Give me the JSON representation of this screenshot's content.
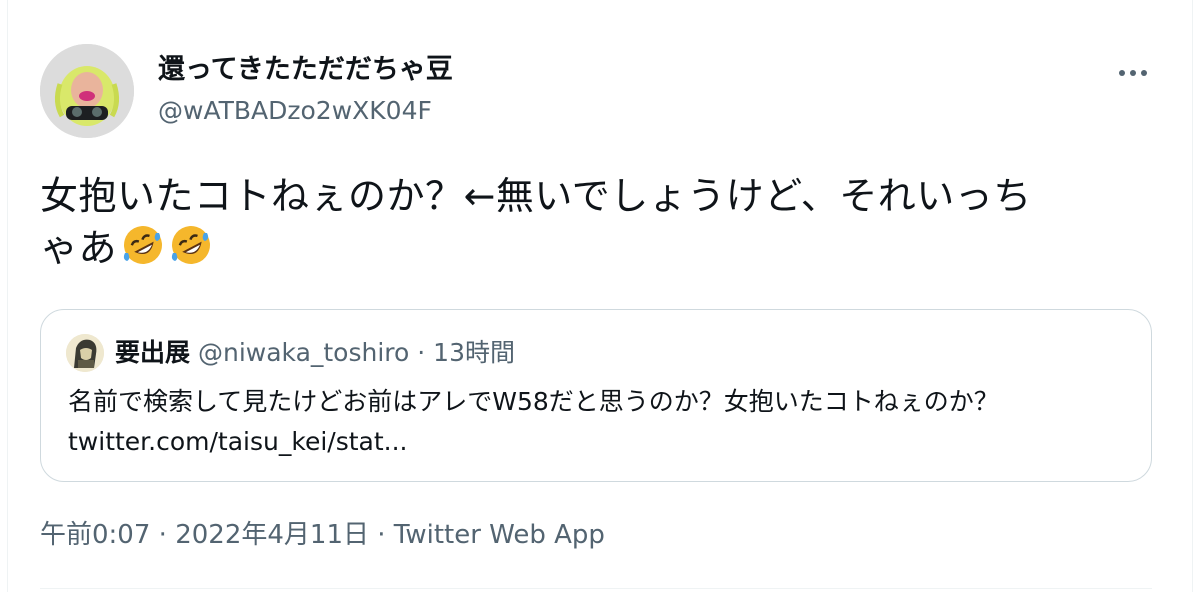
{
  "tweet": {
    "author": {
      "display_name": "還ってきたただだちゃ豆",
      "handle": "@wATBADzo2wXK04F"
    },
    "text_lines": [
      "女抱いたコトねぇのか？←無いでしょうけど、それいっち",
      "ゃあ"
    ],
    "emojis": [
      "rolling-on-floor-laughing-emoji",
      "rolling-on-floor-laughing-emoji"
    ],
    "more_icon": "more-horizontal-icon",
    "quoted": {
      "display_name": "要出展",
      "meta": "@niwaka_toshiro · 13時間",
      "text_lines": [
        "名前で検索して見たけどお前はアレでW58だと思うのか？女抱いたコトねぇのか？",
        "twitter.com/taisu_kei/stat..."
      ]
    },
    "timestamp": {
      "time": "午前0:07",
      "separator": " · ",
      "date": "2022年4月11日",
      "source": "Twitter Web App"
    }
  },
  "colors": {
    "text_primary": "#0f1419",
    "text_secondary": "#536471",
    "border": "#cfd9de"
  }
}
